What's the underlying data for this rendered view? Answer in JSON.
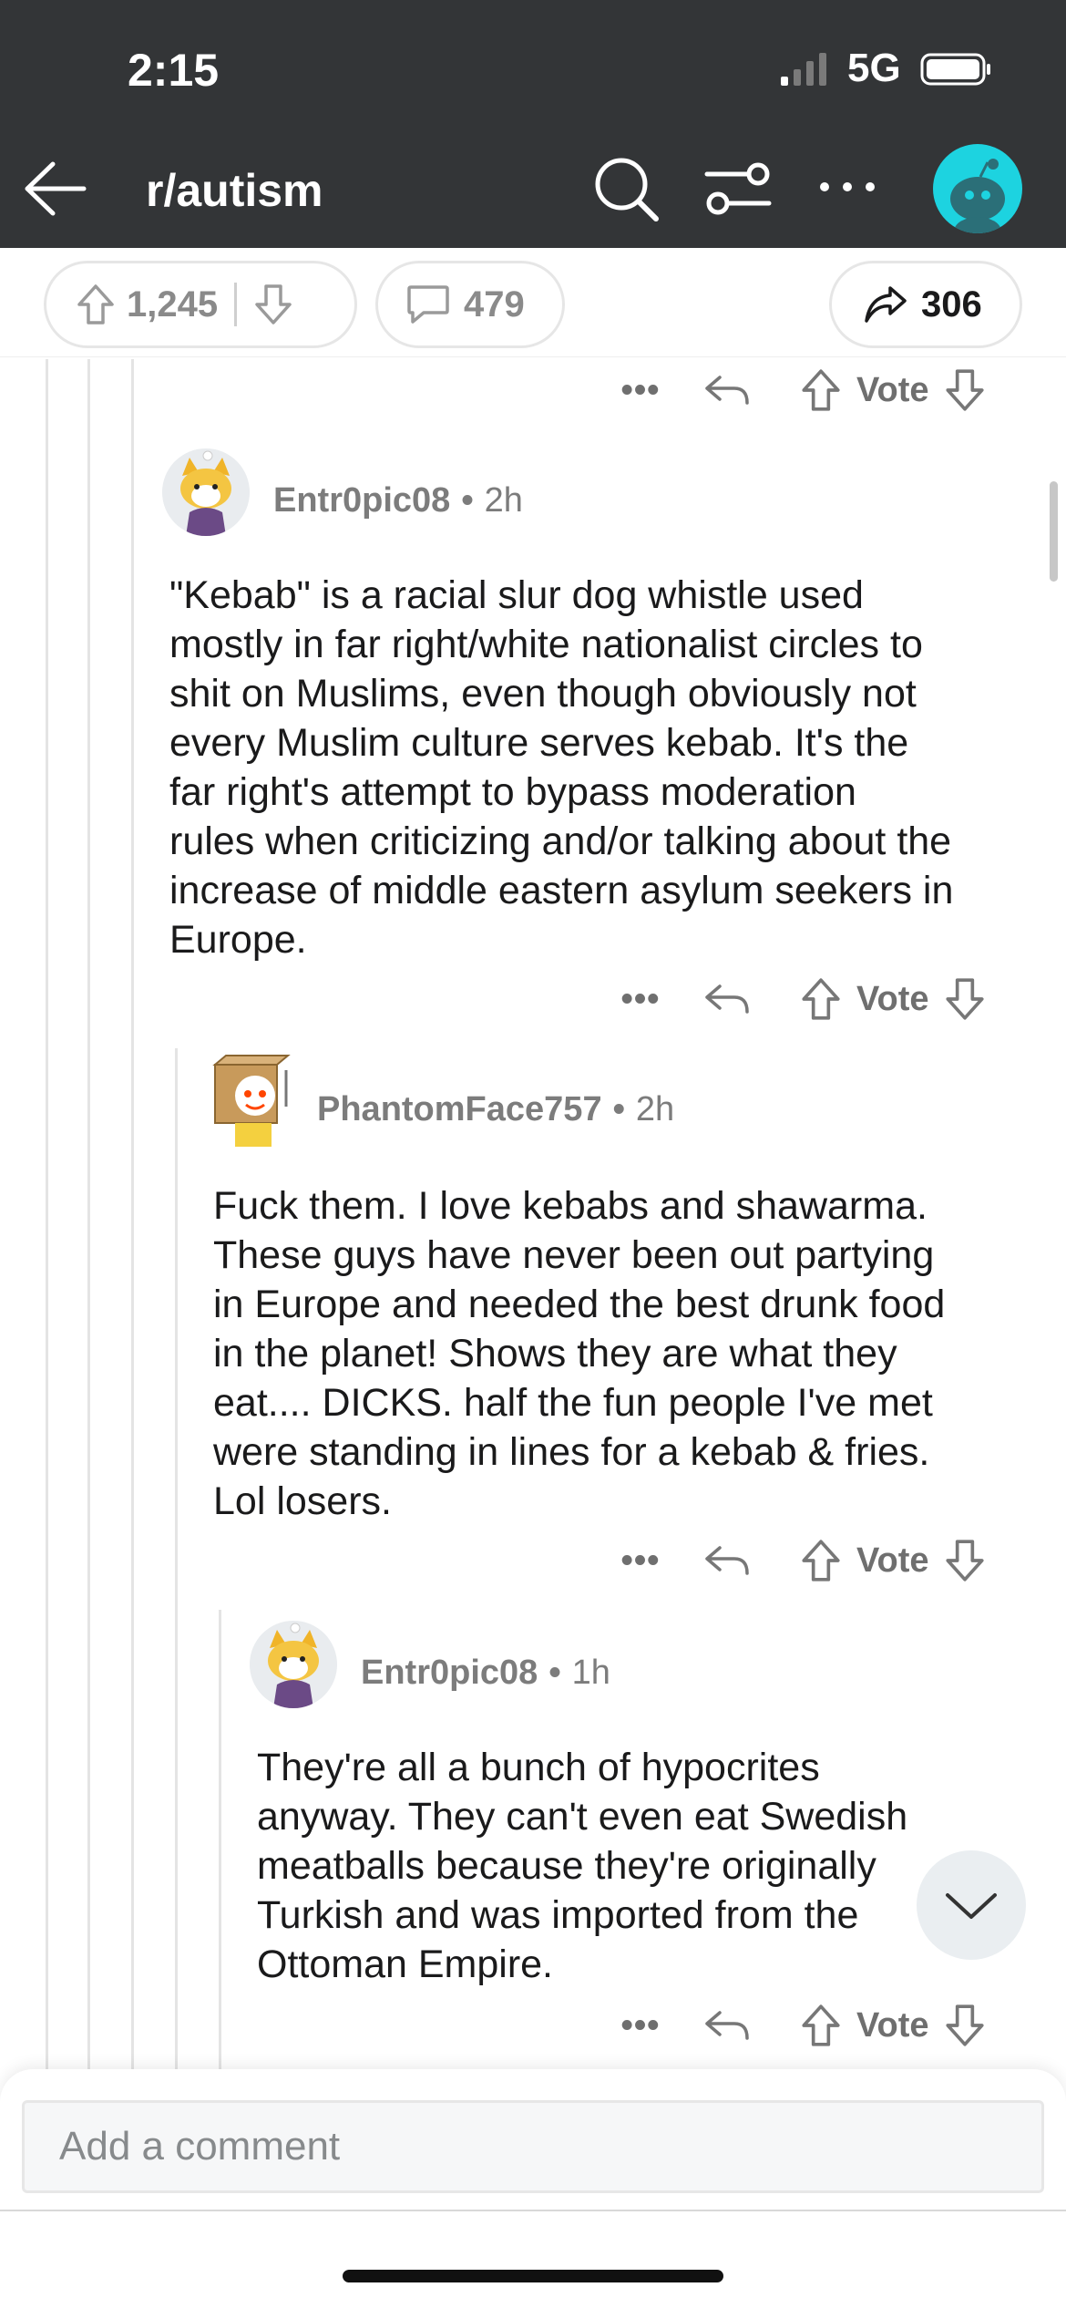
{
  "status_bar": {
    "time": "2:15",
    "network": "5G"
  },
  "header": {
    "subreddit": "r/autism"
  },
  "post_actions": {
    "upvotes": "1,245",
    "comments": "479",
    "shares": "306"
  },
  "actions": {
    "vote_label": "Vote",
    "more": "•••"
  },
  "comments": [
    {
      "username": "Entr0pic08",
      "separator": "•",
      "time": "2h",
      "lines": [
        "\"Kebab\" is a racial slur dog whistle used",
        "mostly in far right/white nationalist circles to",
        "shit on Muslims, even though obviously not",
        "every Muslim culture serves kebab. It's the",
        "far right's attempt to bypass moderation",
        "rules when criticizing and/or talking about the",
        "increase of middle eastern asylum seekers in",
        "Europe."
      ]
    },
    {
      "username": "PhantomFace757",
      "separator": "•",
      "time": "2h",
      "lines": [
        "Fuck them. I love kebabs and shawarma.",
        "These guys have never been out partying",
        "in Europe and needed the best drunk food",
        "in the planet! Shows they are what they",
        "eat.... DICKS. half the fun people I've met",
        "were standing in lines for a kebab & fries.",
        "Lol losers."
      ]
    },
    {
      "username": "Entr0pic08",
      "separator": "•",
      "time": "1h",
      "lines": [
        "They're all a bunch of hypocrites",
        "anyway. They can't even eat Swedish",
        "meatballs because they're originally",
        "Turkish and was imported from the",
        "Ottoman Empire."
      ]
    }
  ],
  "composer": {
    "placeholder": "Add a comment"
  },
  "icons": {
    "back": "arrow-left-icon",
    "search": "search-icon",
    "filter": "sliders-icon",
    "more": "more-horizontal-icon",
    "upvote": "arrow-up-icon",
    "downvote": "arrow-down-icon",
    "comment": "speech-bubble-icon",
    "share": "share-arrow-icon",
    "reply": "reply-arrow-icon",
    "jump": "chevron-down-icon"
  },
  "colors": {
    "header_bg": "#333537",
    "avatar_accent": "#1dd3e0"
  }
}
